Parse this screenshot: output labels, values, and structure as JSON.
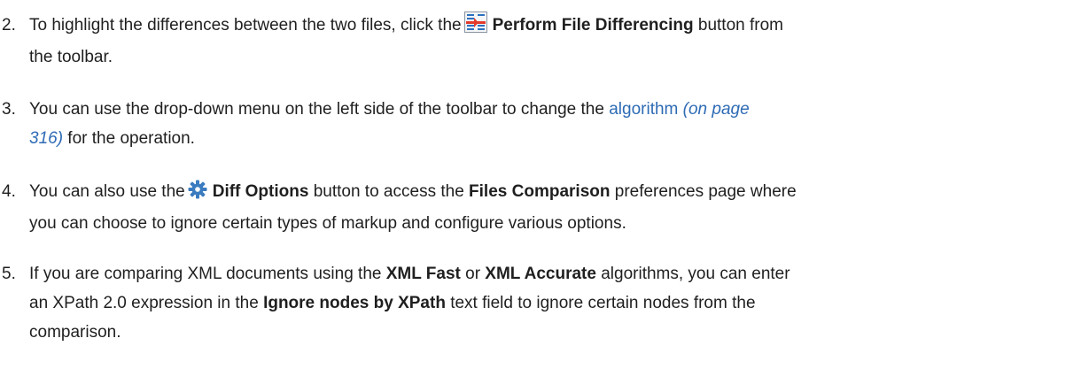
{
  "steps": [
    {
      "number": "2.",
      "t1": "To highlight the differences between the two files, click the",
      "icon": "perform-file-differencing-icon",
      "bold1": "Perform File Differencing",
      "t2": " button from",
      "t3": "the toolbar."
    },
    {
      "number": "3.",
      "t1": "You can use the drop-down menu on the left side of the toolbar to change the",
      "link": "algorithm",
      "ref_a": "(on page",
      "ref_b": "316)",
      "t2": " for the operation."
    },
    {
      "number": "4.",
      "t1": "You can also use the",
      "icon": "gear-icon",
      "bold1": "Diff Options",
      "t2": " button to access the ",
      "bold2": "Files Comparison",
      "t3": " preferences page where",
      "t4": "you can choose to ignore certain types of markup and configure various options."
    },
    {
      "number": "5.",
      "t1": "If you are comparing XML documents using the ",
      "bold1": "XML Fast",
      "t2": " or ",
      "bold2": "XML Accurate",
      "t3": " algorithms, you can enter",
      "t4": "an XPath 2.0 expression in the ",
      "bold3": "Ignore nodes by XPath",
      "t5": " text field to ignore certain nodes from the",
      "t6": "comparison."
    }
  ],
  "colors": {
    "link": "#2e6bb5",
    "text": "#1f1f1f",
    "gear": "#3b7bbf"
  }
}
